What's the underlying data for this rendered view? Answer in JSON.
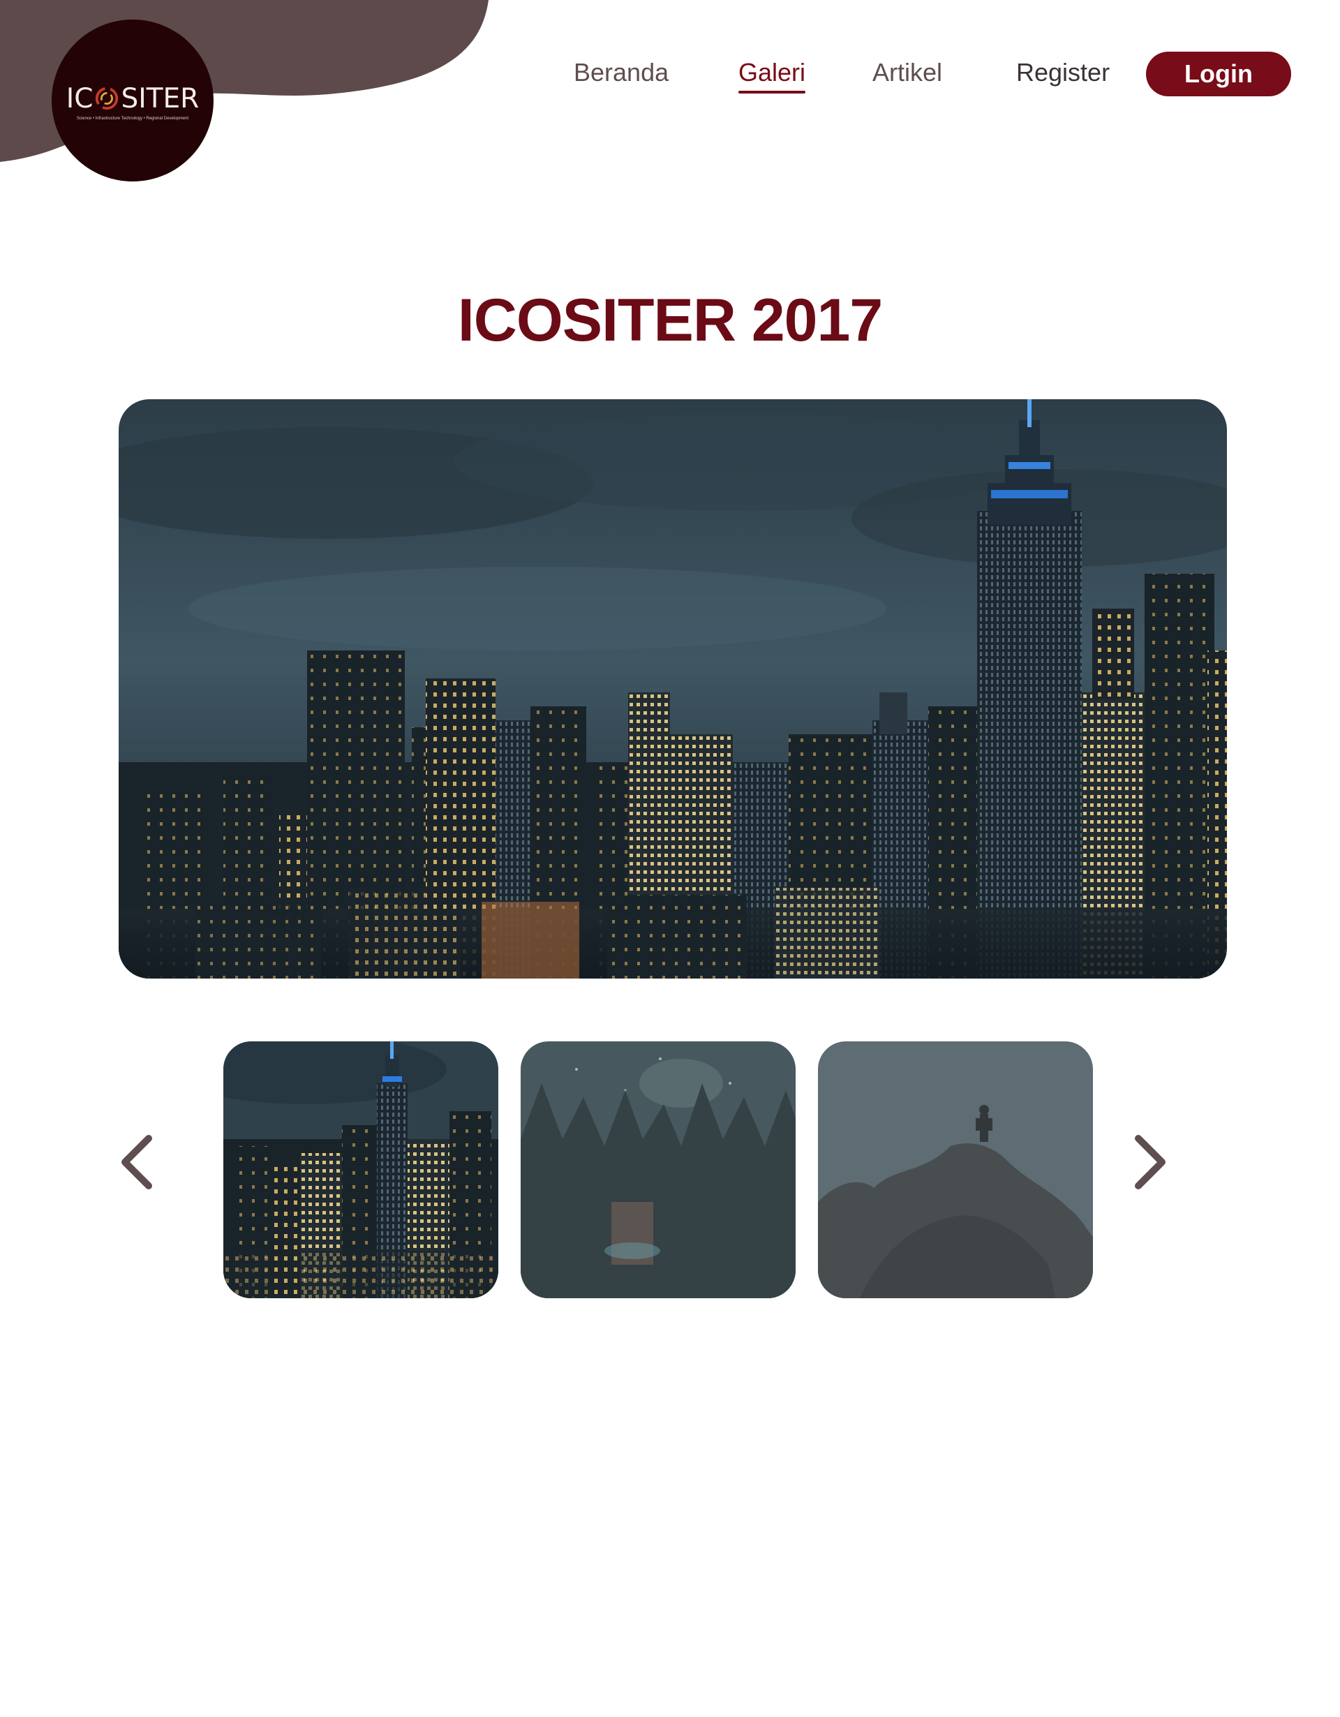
{
  "logo": {
    "word_left": "IC",
    "word_right": "SITER",
    "tagline": "Science • Infrastructure Technology • Regional Development"
  },
  "nav": {
    "items": [
      {
        "label": "Beranda",
        "active": false
      },
      {
        "label": "Galeri",
        "active": true
      },
      {
        "label": "Artikel",
        "active": false
      },
      {
        "label": "Register",
        "active": false
      }
    ],
    "login_label": "Login"
  },
  "gallery": {
    "title": "ICOSITER 2017",
    "selected_index": 0,
    "thumbnails": [
      "city-skyline",
      "starry-forest",
      "person-on-rock"
    ]
  },
  "icons": {
    "prev": "chevron-left-icon",
    "next": "chevron-right-icon"
  },
  "colors": {
    "brand": "#780c18",
    "blob": "#5e4a4b",
    "logo_bg": "#230305",
    "arrow": "#5e4e4f"
  }
}
